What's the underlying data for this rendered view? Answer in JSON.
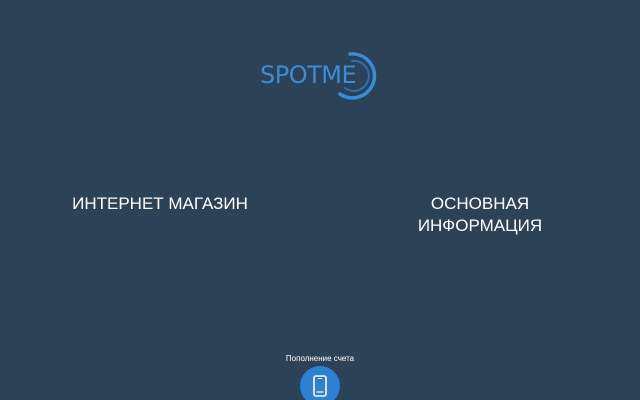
{
  "logo": {
    "text": "SPOTME",
    "color": "#3a8bd8"
  },
  "menu": {
    "shop_label": "ИНТЕРНЕТ МАГАЗИН",
    "info_line1": "ОСНОВНАЯ",
    "info_line2": "ИНФОРМАЦИЯ"
  },
  "topup": {
    "label": "Пополнение счета",
    "icon": "phone-icon",
    "button_color": "#2f7fd2"
  },
  "colors": {
    "background": "#2c4357",
    "text": "#ffffff"
  }
}
